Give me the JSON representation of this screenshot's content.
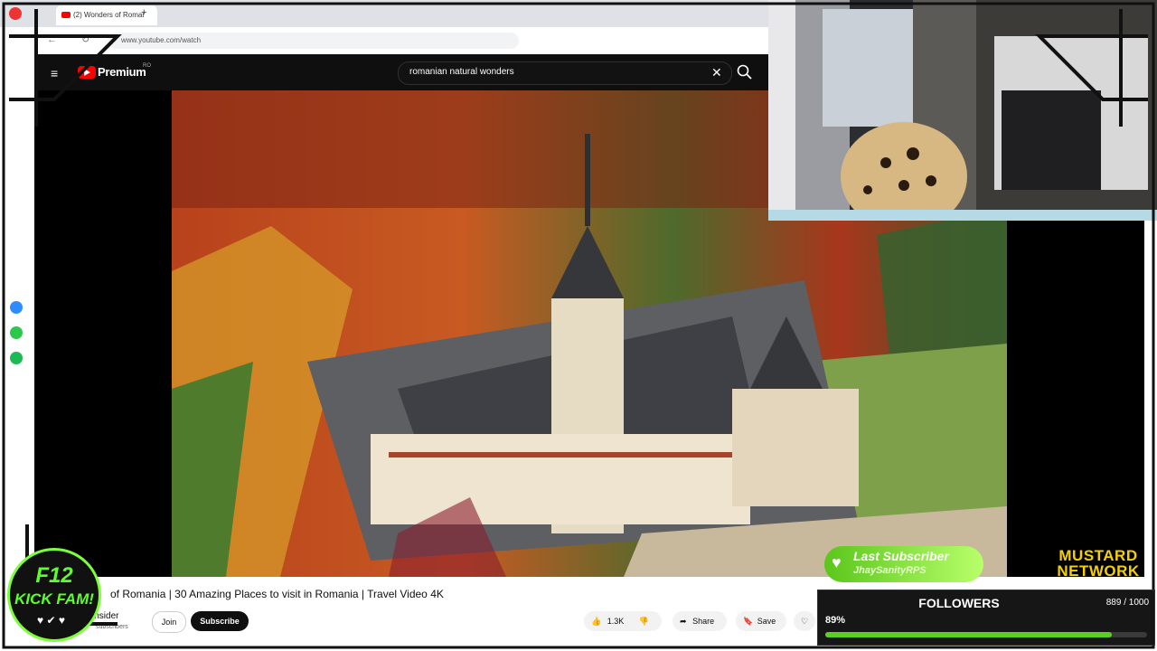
{
  "browser": {
    "tab_title": "(2) Wonders of Romar",
    "new_tab": "+",
    "url": "www.youtube.com/watch"
  },
  "youtube": {
    "menu_glyph": "≡",
    "logo_text": "Premium",
    "region": "RO",
    "search_query": "romanian natural wonders",
    "clear_glyph": "✕"
  },
  "video": {
    "title": "of Romania | 30 Amazing Places to visit in Romania | Travel Video 4K",
    "channel": "insider",
    "subscribers": "subscribers",
    "join_label": "Join",
    "subscribe_label": "Subscribe",
    "likes": "1.3K",
    "share_label": "Share",
    "save_label": "Save"
  },
  "overlay": {
    "logo_line1": "F12",
    "logo_line2": "KICK FAM!",
    "last_subscriber_title": "Last Subscriber",
    "last_subscriber_name": "JhaySanityRPS",
    "brand_line1": "MUSTARD",
    "brand_line2": "NETWORK",
    "followers_title": "FOLLOWERS",
    "followers_count": "889 / 1000",
    "followers_percent_label": "89%",
    "followers_progress": 0.89
  },
  "colors": {
    "accent_green": "#5ad11e",
    "youtube_red": "#ff0000",
    "brand_yellow": "#f4d000"
  }
}
